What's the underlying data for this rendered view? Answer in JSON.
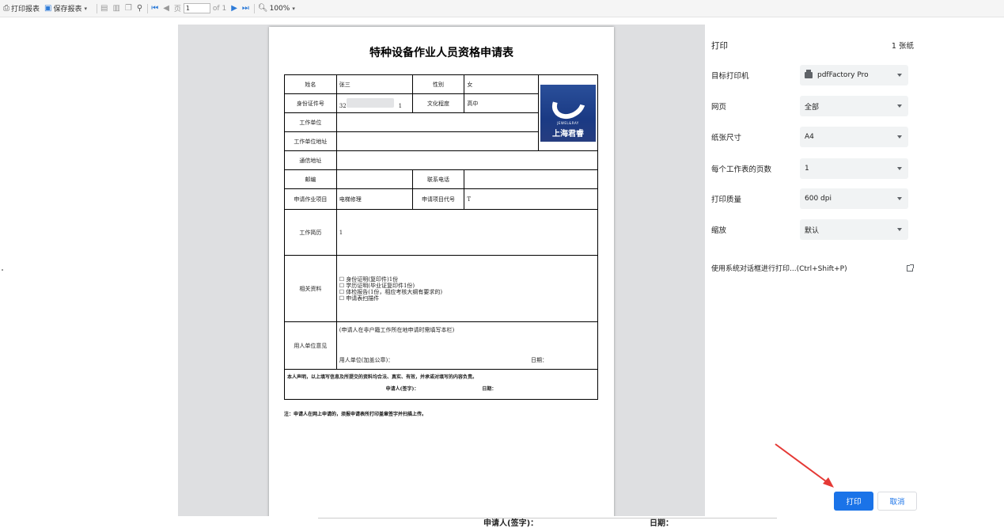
{
  "toolbar": {
    "print_report": "打印报表",
    "save_report": "保存报表",
    "page_prefix": "页",
    "page_value": "1",
    "page_of": "of 1",
    "zoom": "100%"
  },
  "form": {
    "title": "特种设备作业人员资格申请表",
    "name_label": "姓名",
    "name_value": "张三",
    "gender_label": "性别",
    "gender_value": "女",
    "id_label": "身份证件号",
    "id_value_start": "32",
    "id_value_end": "1",
    "edu_label": "文化程度",
    "edu_value": "高中",
    "work_unit_label": "工作单位",
    "work_addr_label": "工作单位地址",
    "mail_addr_label": "通信地址",
    "zip_label": "邮编",
    "phone_label": "联系电话",
    "project_label": "申请作业项目",
    "project_value": "电梯修理",
    "project_code_label": "申请项目代号",
    "project_code_value": "T",
    "resume_label": "工作简历",
    "resume_value": "1",
    "materials_label": "相关资料",
    "materials": [
      "☐ 身份证明(复印件)1份",
      "☐ 学历证明(毕业证复印件1份)",
      "☐ 体检报告(1份，相应考核大纲有要求的)",
      "☐ 申请表扫描件"
    ],
    "opinion_label": "用人单位意见",
    "opinion_note": "(申请人在非户籍工作所在地申请时需填写本栏)",
    "opinion_stamp": "用人单位(加盖公章)：",
    "opinion_date": "日期：",
    "declaration": "本人声明，以上填写信息及所提交的资料均合法、真实、有效，并承诺对填写的内容负责。",
    "applicant_sign": "申请人(签字)：",
    "applicant_date": "日期：",
    "footnote": "注：申请人在网上申请的，须报申请表所打印盖章签字并扫描上传。",
    "photo_brand_en": "JEWEL&RAY",
    "photo_brand_cn": "上海君睿"
  },
  "under": {
    "text1": "申请人(签字)：",
    "text2": "日期："
  },
  "settings": {
    "title": "打印",
    "sheet_count": "1 张纸",
    "rows": [
      {
        "label": "目标打印机",
        "value": "pdfFactory Pro"
      },
      {
        "label": "网页",
        "value": "全部"
      },
      {
        "label": "纸张尺寸",
        "value": "A4"
      },
      {
        "label": "每个工作表的页数",
        "value": "1"
      },
      {
        "label": "打印质量",
        "value": "600 dpi"
      },
      {
        "label": "缩放",
        "value": "默认"
      }
    ],
    "system_dialog": "使用系统对话框进行打印...(Ctrl+Shift+P)",
    "print_button": "打印",
    "cancel_button": "取消"
  },
  "colors": {
    "primary": "#1a73e8",
    "annotation_arrow": "#e53935"
  }
}
